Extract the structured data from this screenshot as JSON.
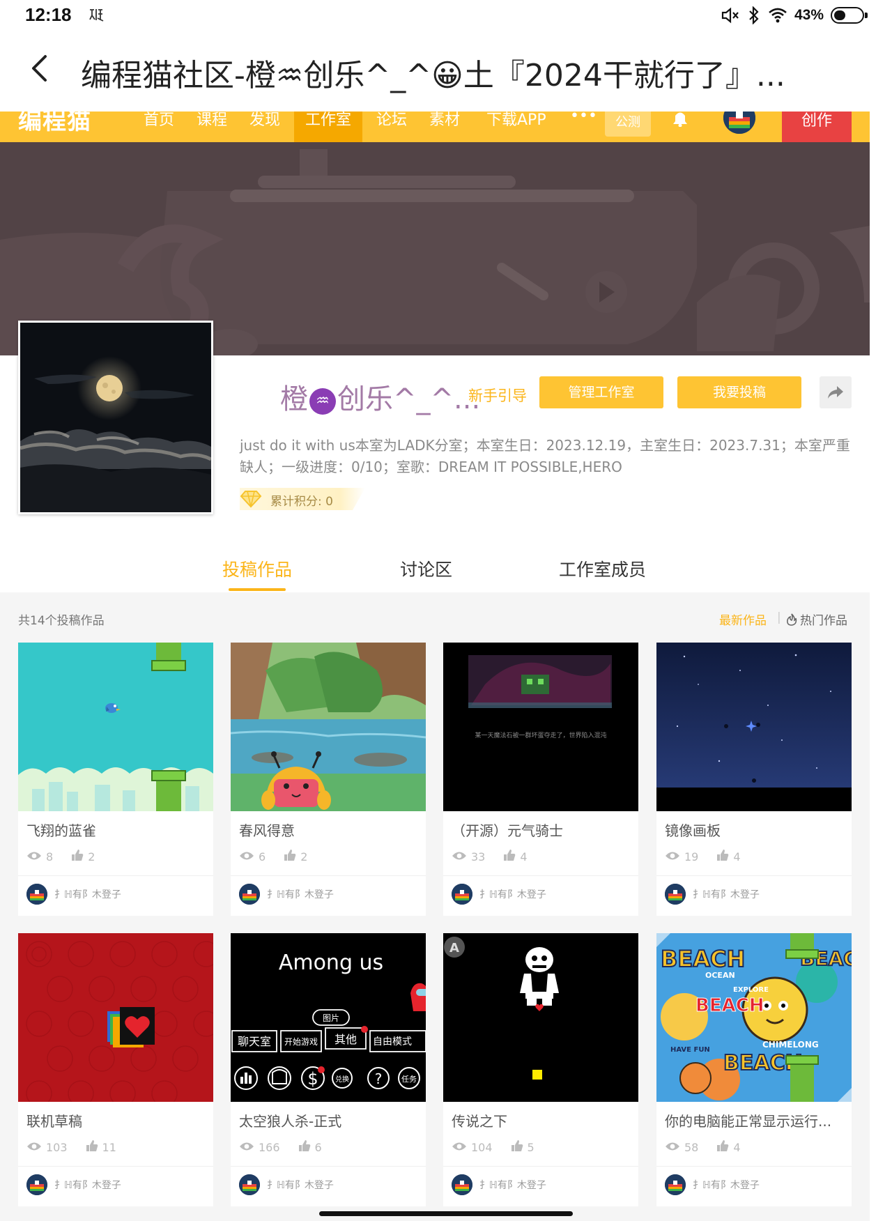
{
  "status_bar": {
    "time": "12:18",
    "battery_text": "43%",
    "battery_level": 0.43
  },
  "title_bar": {
    "title": "编程猫社区-橙♒创乐^_^😀土『2024干就行了』..."
  },
  "site_header": {
    "logo": "编程猫",
    "nav": [
      "首页",
      "课程",
      "发现",
      "工作室",
      "论坛",
      "素材",
      "下载APP",
      "•••"
    ],
    "active_nav": "工作室",
    "beta_badge": "公测",
    "create_button": "创作"
  },
  "studio": {
    "name_prefix": "橙",
    "name_suffix": "创乐^_^...",
    "guide_link": "新手引导",
    "manage_button": "管理工作室",
    "submit_button": "我要投稿",
    "description": "just do it with us本室为LADK分室；本室生日：2023.12.19，主室生日：2023.7.31；本室严重缺人；一级进度：0/10；室歌：DREAM IT POSSIBLE,HERO",
    "points_label": "累计积分: 0"
  },
  "tabs": [
    {
      "label": "投稿作品",
      "active": true
    },
    {
      "label": "讨论区",
      "active": false
    },
    {
      "label": "工作室成员",
      "active": false
    }
  ],
  "works": {
    "count_label": "共14个投稿作品",
    "sort_latest": "最新作品",
    "sort_separator": "|",
    "sort_hot": "热门作品",
    "items": [
      {
        "title": "飞翔的蓝雀",
        "views": "8",
        "likes": "2",
        "author": "扌ℍ有阝木登子",
        "thumb": "flappy"
      },
      {
        "title": "春风得意",
        "views": "6",
        "likes": "2",
        "author": "扌ℍ有阝木登子",
        "thumb": "spring"
      },
      {
        "title": "（开源）元气骑士",
        "views": "33",
        "likes": "4",
        "author": "扌ℍ有阝木登子",
        "thumb": "knight",
        "thumb_caption": "某一天魔法石被一群坏蛋夺走了，世界陷入混沌"
      },
      {
        "title": "镜像画板",
        "views": "19",
        "likes": "4",
        "author": "扌ℍ有阝木登子",
        "thumb": "night"
      },
      {
        "title": "联机草稿",
        "views": "103",
        "likes": "11",
        "author": "扌ℍ有阝木登子",
        "thumb": "red"
      },
      {
        "title": "太空狼人杀-正式",
        "views": "166",
        "likes": "6",
        "author": "扌ℍ有阝木登子",
        "thumb": "among",
        "thumb_text": {
          "heading": "Among us",
          "tag": "图片",
          "btn1": "聊天室",
          "btn2": "开始游戏",
          "btn3": "其他",
          "btn4": "自由模式",
          "icon_exchange": "兑换",
          "icon_task": "任务"
        }
      },
      {
        "title": "传说之下",
        "views": "104",
        "likes": "5",
        "author": "扌ℍ有阝木登子",
        "thumb": "undertale"
      },
      {
        "title": "你的电脑能正常显示运行...",
        "views": "58",
        "likes": "4",
        "author": "扌ℍ有阝木登子",
        "thumb": "beach",
        "thumb_words": [
          "BEACH",
          "OCEAN",
          "HAVE FUN",
          "EXPLORE",
          "CHIMELONG"
        ]
      }
    ]
  },
  "colors": {
    "brand_yellow": "#fec433",
    "accent_orange": "#fbb51a",
    "create_red": "#e84242",
    "banner_bg": "#524346",
    "name_purple": "#a37aa6"
  }
}
